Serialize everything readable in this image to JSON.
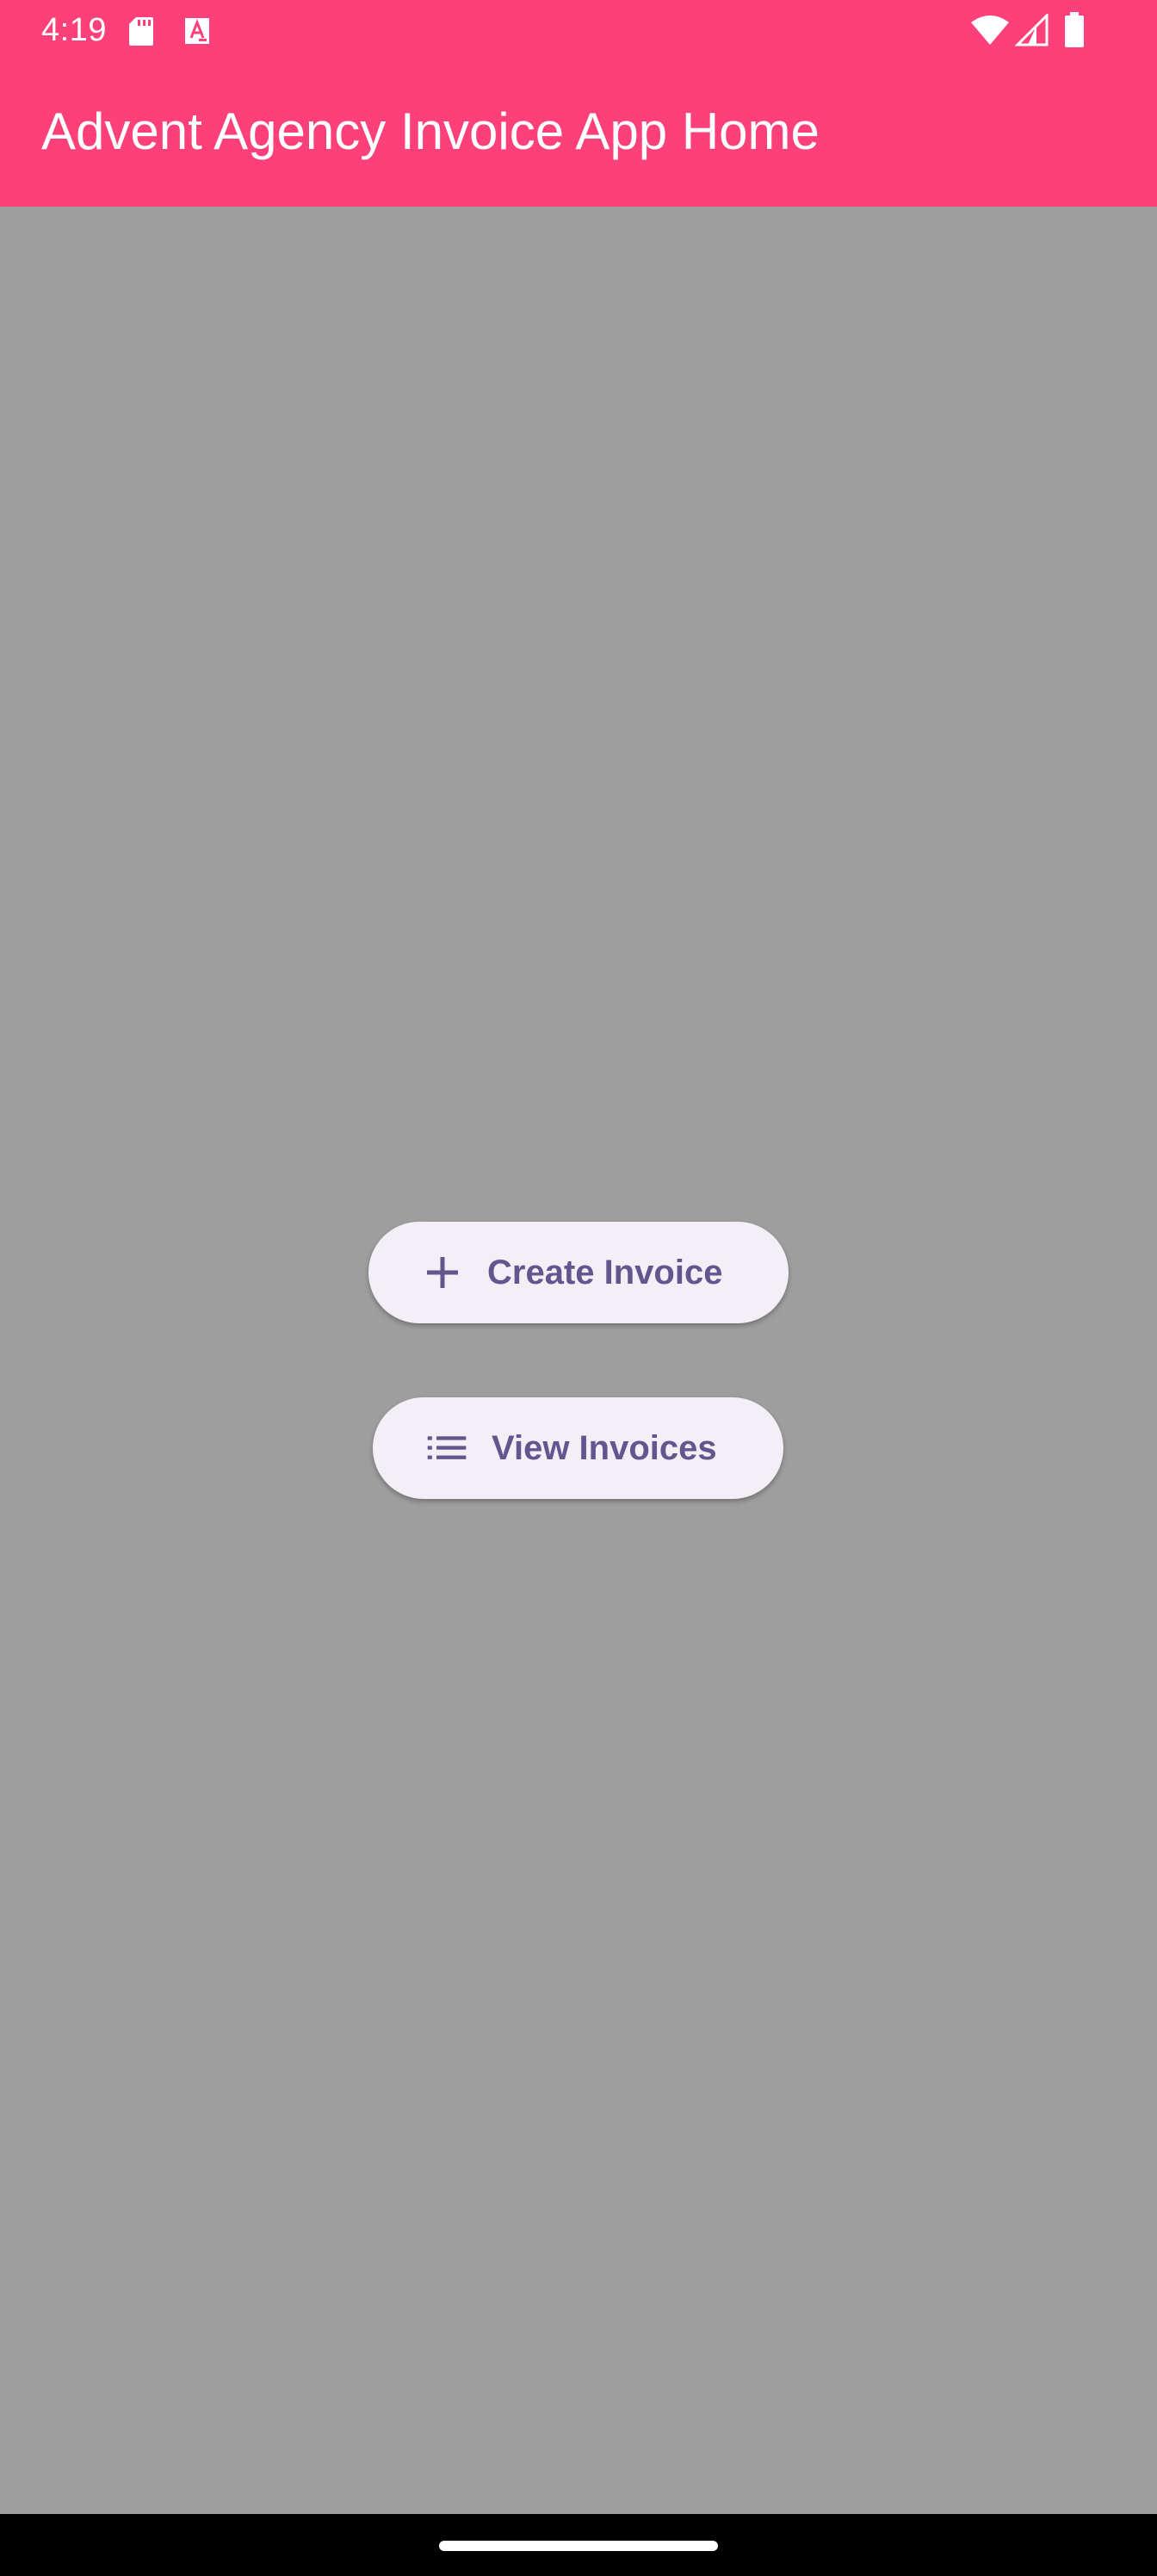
{
  "status_bar": {
    "time": "4:19",
    "icons": [
      "sd-card-icon",
      "text-a-icon",
      "wifi-icon",
      "signal-icon",
      "battery-icon"
    ]
  },
  "app_bar": {
    "title": "Advent Agency Invoice App Home",
    "background_color": "#fe407a"
  },
  "main": {
    "background_color": "#9e9e9e",
    "buttons": [
      {
        "label": "Create Invoice",
        "icon": "plus-icon"
      },
      {
        "label": "View Invoices",
        "icon": "list-icon"
      }
    ],
    "button_text_color": "#65558f",
    "button_background_color": "#f4eff6"
  },
  "nav_bar": {
    "gesture_handle": "home-gesture-bar"
  }
}
